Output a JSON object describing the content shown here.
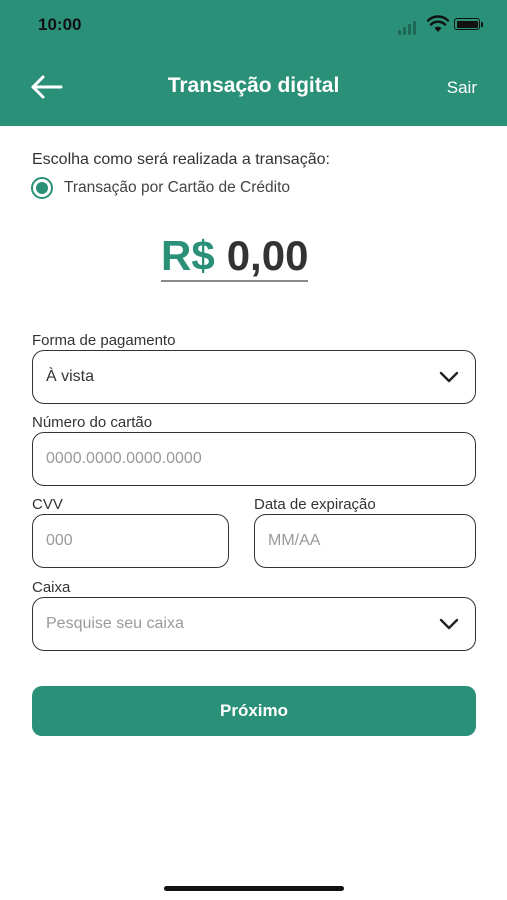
{
  "status_bar": {
    "time": "10:00"
  },
  "header": {
    "title": "Transação digital",
    "logout_label": "Sair",
    "back_icon": "arrow-left-icon"
  },
  "colors": {
    "brand": "#2a9077",
    "text": "#333333",
    "placeholder": "#9a9a9a"
  },
  "transaction": {
    "prompt": "Escolha como será realizada a transação:",
    "option_label": "Transação por Cartão de Crédito",
    "option_selected": true,
    "currency": "R$",
    "amount": "0,00"
  },
  "form": {
    "payment": {
      "label": "Forma de pagamento",
      "value": "À vista"
    },
    "card_number": {
      "label": "Número do cartão",
      "placeholder": "0000.0000.0000.0000"
    },
    "cvv": {
      "label": "CVV",
      "placeholder": "000"
    },
    "expiry": {
      "label": "Data de expiração",
      "placeholder": "MM/AA"
    },
    "cashier": {
      "label": "Caixa",
      "placeholder": "Pesquise seu caixa"
    }
  },
  "next_button": {
    "label": "Próximo"
  }
}
